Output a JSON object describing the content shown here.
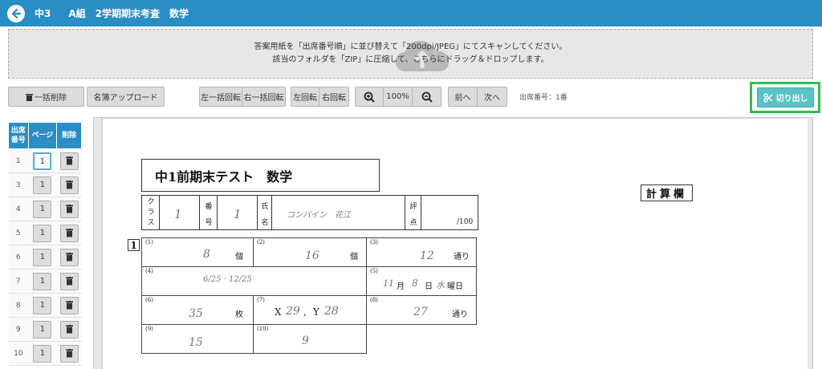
{
  "header": {
    "course": "中3",
    "class_name": "A組",
    "exam_name": "2学期期末考査　数学"
  },
  "upload": {
    "line1": "答案用紙を「出席番号順」に並び替えて「200dpi/JPEG」にてスキャンしてください。",
    "line2": "該当のフォルダを「ZIP」に圧縮して、こちらにドラッグ＆ドロップします。"
  },
  "toolbar": {
    "bulk_delete": "一括削除",
    "roster_upload": "名簿アップロード",
    "rotate_all_left": "左一括回転",
    "rotate_all_right": "右一括回転",
    "rotate_left": "左回転",
    "rotate_right": "右回転",
    "zoom_level": "100%",
    "prev": "前へ",
    "next": "次へ",
    "attendance_label": "出席番号：1番",
    "cut_out": "切り出し"
  },
  "side_table": {
    "headers": [
      "出席\n番号",
      "ページ",
      "削除"
    ],
    "rows": [
      {
        "no": "1",
        "page": "1"
      },
      {
        "no": "3",
        "page": "1"
      },
      {
        "no": "4",
        "page": "1"
      },
      {
        "no": "5",
        "page": "1"
      },
      {
        "no": "6",
        "page": "1"
      },
      {
        "no": "7",
        "page": "1"
      },
      {
        "no": "8",
        "page": "1"
      },
      {
        "no": "9",
        "page": "1"
      },
      {
        "no": "10",
        "page": "1"
      }
    ]
  },
  "paper": {
    "title": "中1前期末テスト　数学",
    "calc_area": "計算欄",
    "class_label": "クラス",
    "class_value": "1",
    "number_label": "番号",
    "number_value": "1",
    "name_label": "氏名",
    "name_value": "コンパイン　花江",
    "score_label": "評点",
    "score_max": "/100",
    "question_number": "1",
    "answers": [
      {
        "num": "(1)",
        "value": "8",
        "unit": "個"
      },
      {
        "num": "(2)",
        "value": "16",
        "unit": "個"
      },
      {
        "num": "(3)",
        "value": "12",
        "unit": "通り"
      },
      {
        "num": "(4)",
        "value": "6/25 · 12/25",
        "unit": ""
      },
      {
        "num": "(5)",
        "month": "11",
        "day": "8",
        "weekday": "水",
        "u_month": "月",
        "u_day": "日",
        "u_weekday": "曜日"
      },
      {
        "num": "(6)",
        "value": "35",
        "unit": "枚"
      },
      {
        "num": "(7)",
        "x_label": "X",
        "x_value": "29",
        "y_label": "Y",
        "y_value": "28"
      },
      {
        "num": "(8)",
        "value": "27",
        "unit": "通り"
      },
      {
        "num": "(9)",
        "value": "15",
        "unit": ""
      },
      {
        "num": "(10)",
        "value": "9",
        "unit": ""
      }
    ]
  }
}
